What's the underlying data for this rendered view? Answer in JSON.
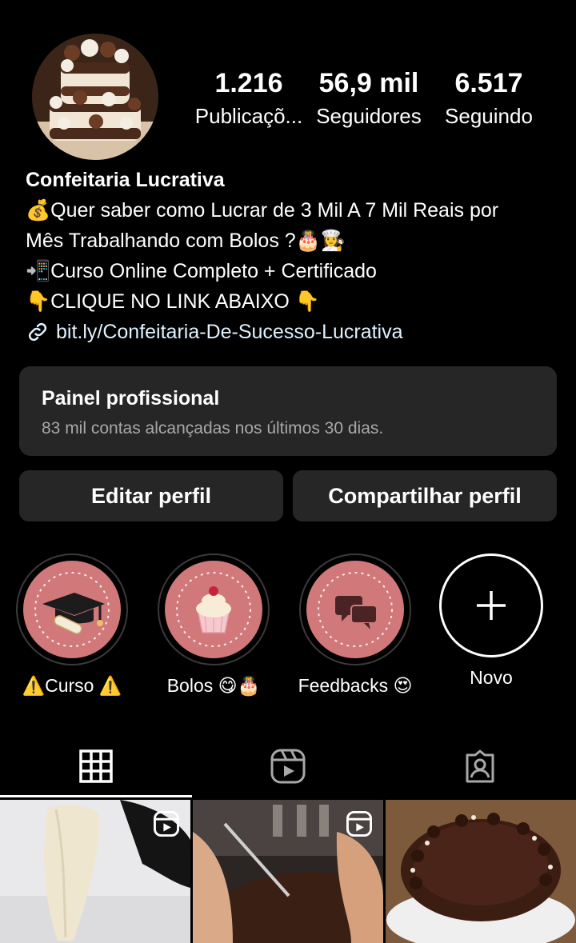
{
  "profile": {
    "avatar_icon": "cake-avatar",
    "stats": [
      {
        "value": "1.216",
        "label": "Publicaçõ..."
      },
      {
        "value": "56,9 mil",
        "label": "Seguidores"
      },
      {
        "value": "6.517",
        "label": "Seguindo"
      }
    ]
  },
  "bio": {
    "name": "Confeitaria Lucrativa",
    "lines": [
      "💰Quer saber como Lucrar de 3 Mil A 7 Mil Reais por",
      "Mês Trabalhando com Bolos ?🎂👩‍🍳",
      "📲Curso Online Completo + Certificado",
      "👇CLIQUE NO LINK ABAIXO 👇"
    ],
    "link": "bit.ly/Confeitaria-De-Sucesso-Lucrativa",
    "link_icon": "link-icon"
  },
  "panel": {
    "title": "Painel profissional",
    "subtitle": "83 mil contas alcançadas nos últimos 30 dias."
  },
  "buttons": {
    "edit": "Editar perfil",
    "share": "Compartilhar perfil"
  },
  "highlights": [
    {
      "label": "⚠️Curso ⚠️",
      "icon": "graduation-cap-icon"
    },
    {
      "label": "Bolos 😋🎂",
      "icon": "cupcake-icon"
    },
    {
      "label": "Feedbacks 😍",
      "icon": "chat-bubbles-icon"
    },
    {
      "label": "Novo",
      "icon": "plus-icon"
    }
  ],
  "tabs": [
    {
      "icon": "grid-icon",
      "active": true
    },
    {
      "icon": "reels-icon",
      "active": false
    },
    {
      "icon": "tagged-icon",
      "active": false
    }
  ],
  "colors": {
    "background": "#000000",
    "surface": "#262626",
    "highlight_fill": "#d0787a",
    "secondary_text": "#a8a8a8"
  }
}
